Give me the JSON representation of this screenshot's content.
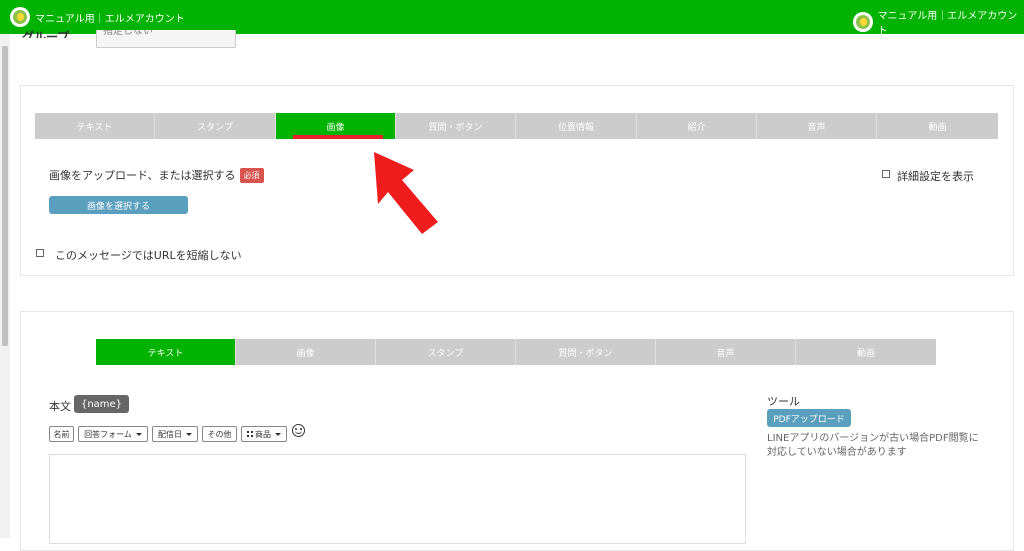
{
  "header": {
    "left_brand": "マニュアル用｜エルメアカウント",
    "right_brand": "マニュアル用｜エルメアカウント"
  },
  "top_cutoff": {
    "label": "グループ",
    "select_value": "指定しない"
  },
  "message1": {
    "tabs": [
      "テキスト",
      "スタンプ",
      "画像",
      "質問・ボタン",
      "位置情報",
      "紹介",
      "音声",
      "動画"
    ],
    "active_tab": "画像",
    "upload_label": "画像をアップロード、または選択する",
    "required_badge": "必須",
    "select_image_button": "画像を選択する",
    "advanced_settings_label": "詳細設定を表示",
    "no_shorten_url_label": "このメッセージではURLを短縮しない"
  },
  "message2": {
    "tabs": [
      "テキスト",
      "画像",
      "スタンプ",
      "質問・ボタン",
      "音声",
      "動画"
    ],
    "active_tab": "テキスト",
    "body_label": "本文",
    "name_tag": "{name}",
    "toolbar": {
      "name": "名前",
      "answer_form": "回答フォーム",
      "delivery_date": "配信日",
      "other": "その他",
      "product": "商品"
    },
    "tools_title": "ツール",
    "pdf_upload_button": "PDFアップロード",
    "pdf_note": "LINEアプリのバージョンが古い場合PDF閲覧に対応していない場合があります"
  },
  "colors": {
    "brand_green": "#00b300",
    "tab_gray": "#cccccc",
    "accent_red": "#e8202a",
    "button_blue": "#5b9fbe",
    "badge_red": "#d9534f"
  }
}
